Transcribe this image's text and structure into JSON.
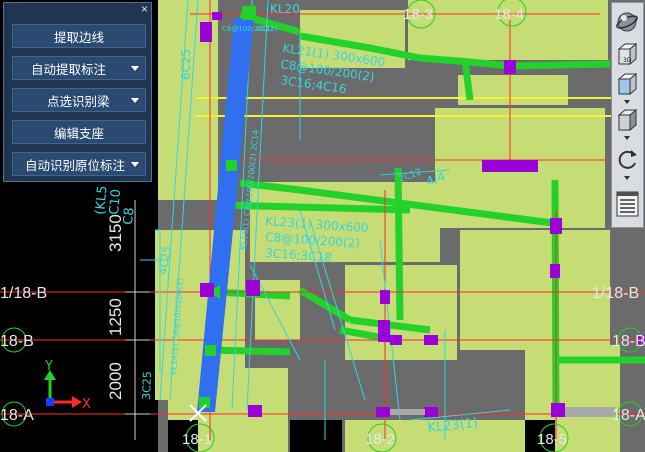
{
  "panel": {
    "buttons": [
      {
        "label": "提取边线",
        "dropdown": false
      },
      {
        "label": "自动提取标注",
        "dropdown": true
      },
      {
        "label": "点选识别梁",
        "dropdown": true
      },
      {
        "label": "编辑支座",
        "dropdown": false
      },
      {
        "label": "自动识别原位标注",
        "dropdown": true
      }
    ],
    "close_glyph": "×"
  },
  "axes": {
    "top": [
      "18-3",
      "18-4"
    ],
    "bottom": [
      "18-1",
      "18-2",
      "18-5"
    ],
    "left": [
      "1/18-B",
      "18-B",
      "18-A"
    ],
    "right": [
      "1/18-B",
      "18-B",
      "18-A"
    ]
  },
  "dimensions": [
    "3150",
    "1250",
    "2000"
  ],
  "ucs": {
    "x": "X",
    "y": "Y"
  },
  "beam_annotations": {
    "kl_top": "KL20",
    "kl_top_detail": "C8@100/200(2)",
    "kl_beam_a": "KL21(1) 300x600",
    "kl_beam_a_rebar": "C8@100/200(2)",
    "kl_beam_a_bottom": "3C16;4C16",
    "kl_beam_b": "KL23(1) 300x600",
    "kl_beam_b_rebar": "C8@100/200(2)",
    "kl_beam_b_bottom": "3C16;3C18",
    "kl_bottom": "KL23(1)",
    "rebar_6c25": "6C25",
    "rebar_4c25": "4C25",
    "rebar_3c25": "3C25",
    "rebar_4c12": "4C12",
    "kl_side": "(KL5",
    "kl_side_c10": "C10",
    "kl_side_c8": "C8",
    "label_4_4": "4/4",
    "label_2c12": "2C12",
    "kl_vertical": "KL14(1) C8@100/200(2)",
    "kl_vertical_b": "KL16(1) C8@100/200(2) 2C14"
  },
  "view_toolbar": {
    "icons": [
      "orbit-globe-icon",
      "view-3d-box-icon",
      "view-front-box-icon",
      "view-iso-box-icon",
      "rotate-icon",
      "layer-panel-icon"
    ],
    "label_3d": "3D"
  },
  "colors": {
    "background": "#000000",
    "slab_green": "#c6dc74",
    "floor_gray": "#6b6b6b",
    "beam_green": "#22d22a",
    "selected_beam": "#2f6ff0",
    "column_magenta": "#9a00d8",
    "axis_red": "#ff2a2a",
    "cyan_line": "#33d6e0",
    "yellow_line": "#f2f237",
    "panel_bg": "#1f3550",
    "button_bg": "#2a4a72"
  }
}
